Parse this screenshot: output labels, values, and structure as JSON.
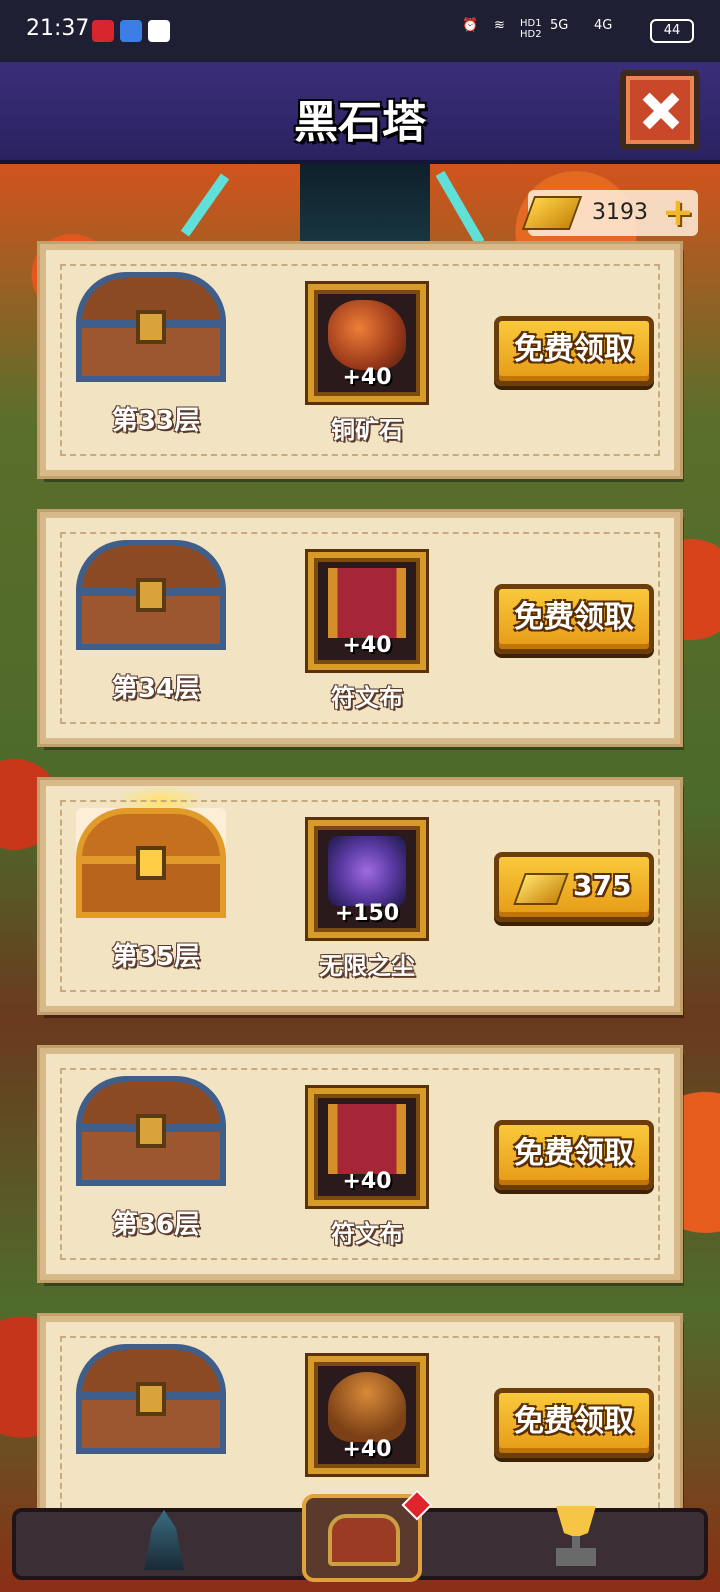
{
  "status_bar": {
    "time": "21:37",
    "battery": "44",
    "network1": "5G",
    "network2": "4G",
    "hd": "HD1 HD2"
  },
  "header": {
    "title": "黑石塔"
  },
  "currency": {
    "gold_amount": "3193",
    "plus": "+"
  },
  "rewards": [
    {
      "floor": "第33层",
      "item": "铜矿石",
      "qty": "+40",
      "action": "免费领取",
      "chest": "blue",
      "icon": "copper-ore-icon"
    },
    {
      "floor": "第34层",
      "item": "符文布",
      "qty": "+40",
      "action": "免费领取",
      "chest": "blue",
      "icon": "rune-cloth-icon"
    },
    {
      "floor": "第35层",
      "item": "无限之尘",
      "qty": "+150",
      "price": "375",
      "chest": "gold",
      "icon": "infinite-dust-icon"
    },
    {
      "floor": "第36层",
      "item": "符文布",
      "qty": "+40",
      "action": "免费领取",
      "chest": "blue",
      "icon": "rune-cloth-icon"
    },
    {
      "floor": "",
      "item": "",
      "qty": "+40",
      "action": "免费领取",
      "chest": "blue",
      "icon": "fiber-icon"
    }
  ],
  "nav": {
    "left": "tower-icon",
    "middle": "chest-icon",
    "right": "trophy-icon"
  },
  "colors": {
    "header_bg": "#2f2668",
    "button_gold": "#f3b22a",
    "card_bg": "#f2e3c3"
  }
}
